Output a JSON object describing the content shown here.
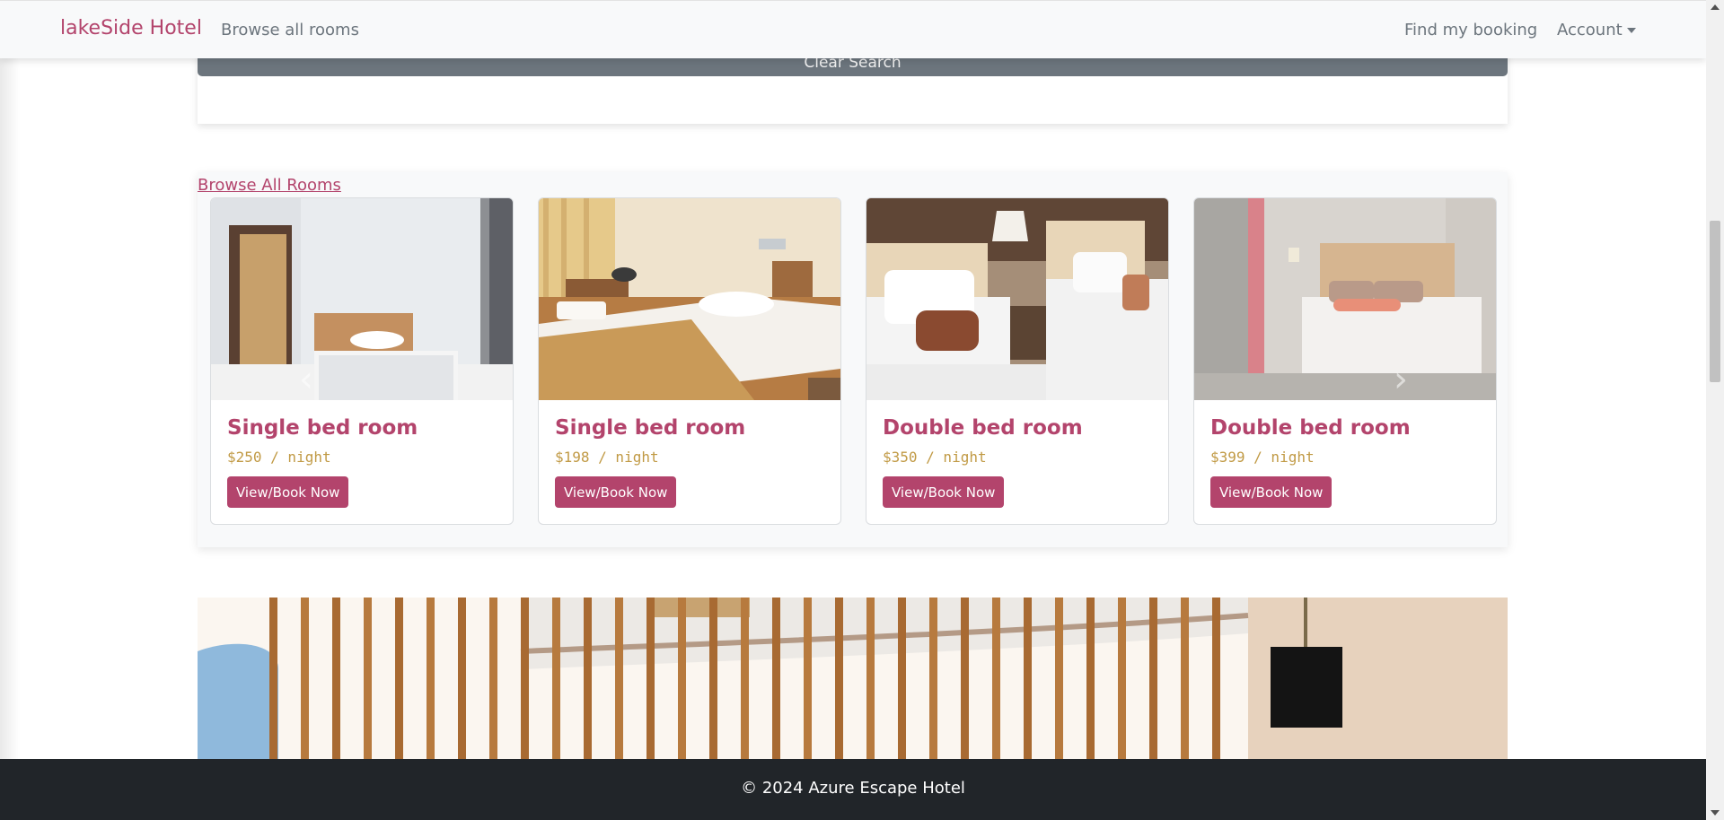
{
  "navbar": {
    "brand": "lakeSide Hotel",
    "browse_all_rooms": "Browse all rooms",
    "find_my_booking": "Find my booking",
    "account": "Account"
  },
  "search": {
    "clear_label": "Clear Search"
  },
  "rooms_section": {
    "link_label": "Browse All Rooms",
    "cards": [
      {
        "title": "Single bed room",
        "price": "$250 / night",
        "button": "View/Book Now"
      },
      {
        "title": "Single bed room",
        "price": "$198 / night",
        "button": "View/Book Now"
      },
      {
        "title": "Double bed room",
        "price": "$350 / night",
        "button": "View/Book Now"
      },
      {
        "title": "Double bed room",
        "price": "$399 / night",
        "button": "View/Book Now"
      }
    ]
  },
  "footer": {
    "text": "© 2024 Azure Escape Hotel"
  },
  "colors": {
    "brand": "#b3446c",
    "price": "#c19a45",
    "footer_bg": "#212529",
    "navbar_bg": "#f8f9fa"
  }
}
